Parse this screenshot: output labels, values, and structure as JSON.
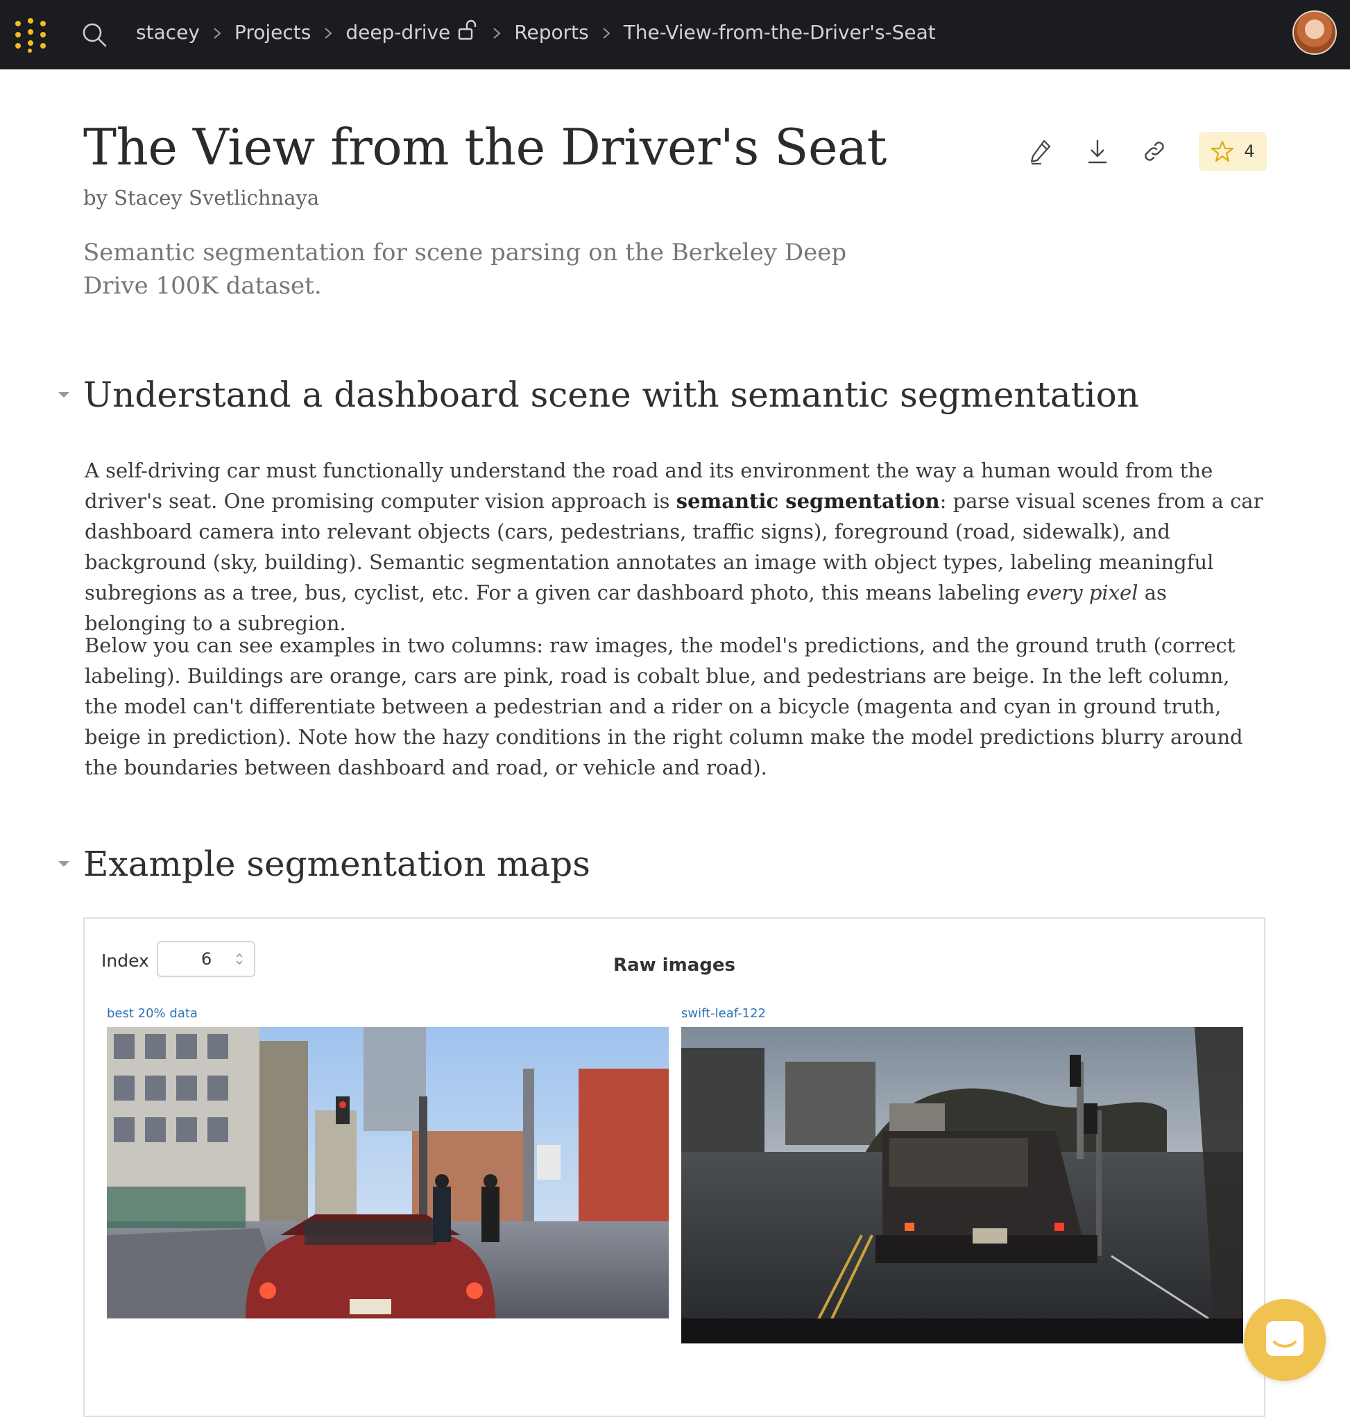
{
  "breadcrumb": {
    "items": [
      "stacey",
      "Projects",
      "deep-drive",
      "Reports",
      "The-View-from-the-Driver's-Seat"
    ]
  },
  "report": {
    "title": "The View from the Driver's Seat",
    "author": "by Stacey Svetlichnaya",
    "description": "Semantic segmentation for scene parsing on the Berkeley Deep Drive 100K dataset.",
    "star_count": "4"
  },
  "sections": [
    {
      "title": "Understand a dashboard scene with semantic segmentation",
      "p1": {
        "before": "A self-driving car must functionally understand the road and its environment the way a human would from the driver's seat. One promising computer vision approach is ",
        "bold": "semantic segmentation",
        "middle": ": parse visual scenes from a car dashboard camera into relevant objects (cars, pedestrians, traffic signs), foreground (road, sidewalk), and background (sky, building). Semantic segmentation annotates an image with object types, labeling meaningful subregions as a tree, bus, cyclist, etc. For a given car dashboard photo, this means labeling ",
        "italic": "every pixel",
        "after": " as belonging to a subregion."
      },
      "p2": "Below you can see examples in two columns: raw images, the model's predictions, and the ground truth (correct labeling). Buildings are orange, cars are pink, road is cobalt blue, and pedestrians are beige. In the left column, the model can't differentiate between a pedestrian and a rider on a bicycle (magenta and cyan in ground truth, beige in prediction). Note how the hazy conditions in the right column make the model predictions blurry around the boundaries between dashboard and road, or vehicle and road)."
    },
    {
      "title": "Example segmentation maps"
    }
  ],
  "panel": {
    "index_label": "Index",
    "index_value": "6",
    "title": "Raw images",
    "runs": [
      {
        "label": "best 20% data",
        "image": "city-street-dashcam-photo"
      },
      {
        "label": "swift-leaf-122",
        "image": "hazy-road-van-dashcam-photo"
      }
    ]
  },
  "icons": {
    "logo": "wandb-logo-icon",
    "search": "search-icon",
    "lock": "unlock-icon",
    "edit": "pencil-icon",
    "download": "download-icon",
    "link": "link-icon",
    "star": "star-icon",
    "chat": "chat-icon"
  },
  "colors": {
    "topbar": "#1a1c1f",
    "accent": "#f5bb27",
    "star_badge": "#fdf2cf",
    "run_label": "#2c74b3",
    "chat_launcher": "#f0c250"
  }
}
